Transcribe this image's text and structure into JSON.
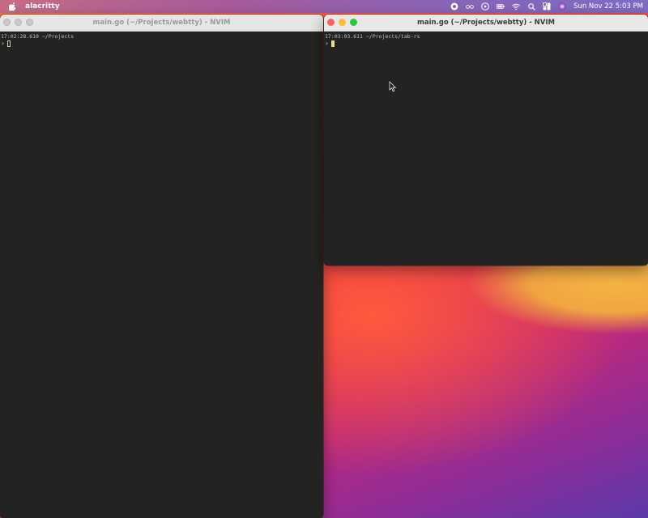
{
  "menubar": {
    "app_name": "alacritty",
    "clock": "Sun Nov 22  5:03 PM",
    "icons": [
      "apple-icon",
      "record-icon",
      "glasses-icon",
      "play-icon",
      "battery-icon",
      "wifi-icon",
      "spotlight-search-icon",
      "control-center-icon",
      "siri-icon"
    ]
  },
  "left_window": {
    "title": "main.go (~/Projects/webtty) - NVIM",
    "focused": false,
    "status_line": "17:02:28.610 ~/Projects",
    "prompt": "›"
  },
  "right_window": {
    "title": "main.go (~/Projects/webtty) - NVIM",
    "focused": true,
    "status_line": "17:03:03.611 ~/Projects/tab-rs",
    "prompt": "›"
  }
}
